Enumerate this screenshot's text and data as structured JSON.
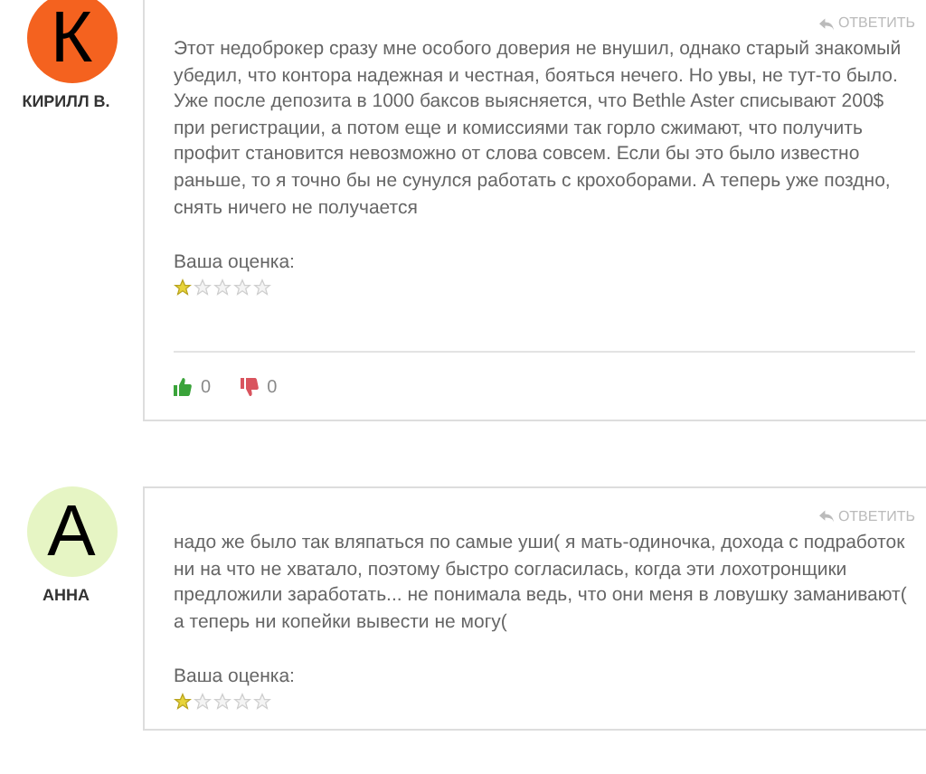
{
  "comments": [
    {
      "avatar": {
        "letter": "К",
        "color": "#f4621f"
      },
      "author": "КИРИЛЛ В.",
      "reply": "ОТВЕТИТЬ",
      "text": "Этот недоброкер сразу мне особого доверия не внушил, однако старый знакомый убедил, что контора надежная и честная, бояться нечего. Но увы, не тут-то было. Уже после депозита в 1000 баксов выясняется, что Bethle Aster списывают 200$ при регистрации, а потом еще и комиссиями так горло сжимают, что получить профит становится невозможно от слова совсем. Если бы это было известно раньше, то я точно бы не сунулся работать с крохоборами. А теперь уже поздно, снять ничего не получается",
      "rating_label": "Ваша оценка:",
      "stars": 1,
      "likes": "0",
      "dislikes": "0"
    },
    {
      "avatar": {
        "letter": "А",
        "color": "#e6f5c4"
      },
      "author": "АННА",
      "reply": "ОТВЕТИТЬ",
      "text": "надо же было так вляпаться по самые уши( я мать-одиночка, дохода с подработок ни на что не хватало, поэтому быстро согласилась, когда эти лохотронщики предложили заработать... не понимала ведь, что они меня в ловушку заманивают( а теперь ни копейки вывести не могу(",
      "rating_label": "Ваша оценка:",
      "stars": 1
    }
  ]
}
